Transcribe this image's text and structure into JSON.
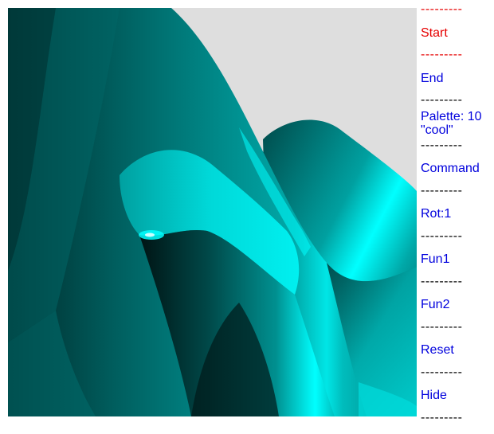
{
  "colors": {
    "active": "#e60000",
    "link": "#0000dd",
    "separator_dark": "#000000",
    "background_canvas": "#dedede",
    "surface_palette_cool": [
      "#001a1a",
      "#004444",
      "#007070",
      "#00a0a0",
      "#00d0d0",
      "#00ffff"
    ]
  },
  "canvas": {
    "icon": "3d-surface-plot"
  },
  "menu": {
    "separator_text": "---------",
    "items": [
      {
        "label": "Start",
        "state": "active"
      },
      {
        "label": "End",
        "state": "link"
      },
      {
        "label": "Palette: 10",
        "label2": "\"cool\"",
        "state": "link"
      },
      {
        "label": "Command",
        "state": "link"
      },
      {
        "label": "Rot:1",
        "state": "link"
      },
      {
        "label": "Fun1",
        "state": "link"
      },
      {
        "label": "Fun2",
        "state": "link"
      },
      {
        "label": "Reset",
        "state": "link"
      },
      {
        "label": "Hide",
        "state": "link"
      }
    ]
  }
}
